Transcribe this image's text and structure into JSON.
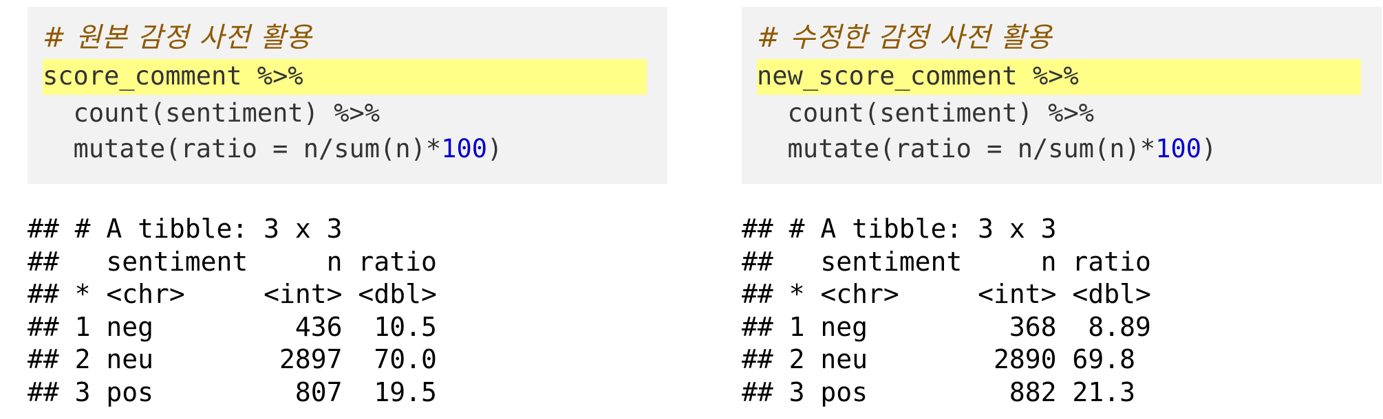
{
  "left": {
    "comment": "# 원본 감정 사전 활용",
    "code_line1": "score_comment %>%",
    "code_line2": "  count(sentiment) %>%",
    "code_line3_prefix": "  mutate(ratio = n/sum(n)*",
    "code_line3_number": "100",
    "code_line3_suffix": ")",
    "output_lines": [
      "## # A tibble: 3 x 3",
      "##   sentiment     n ratio",
      "## * <chr>     <int> <dbl>",
      "## 1 neg         436  10.5",
      "## 2 neu        2897  70.0",
      "## 3 pos         807  19.5"
    ]
  },
  "right": {
    "comment": "# 수정한 감정 사전 활용",
    "code_line1": "new_score_comment %>%",
    "code_line2": "  count(sentiment) %>%",
    "code_line3_prefix": "  mutate(ratio = n/sum(n)*",
    "code_line3_number": "100",
    "code_line3_suffix": ")",
    "output_lines": [
      "## # A tibble: 3 x 3",
      "##   sentiment     n ratio",
      "## * <chr>     <int> <dbl>",
      "## 1 neg         368  8.89",
      "## 2 neu        2890 69.8",
      "## 3 pos         882 21.3"
    ]
  },
  "colors": {
    "code_background": "#f2f2f2",
    "highlight": "#ffff88",
    "comment": "#8f5902",
    "number": "#0000cf"
  }
}
